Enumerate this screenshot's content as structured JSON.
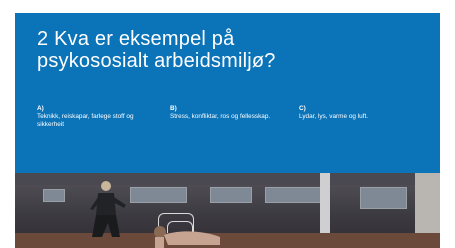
{
  "slide": {
    "title_line1": "2 Kva er eksempel på",
    "title_line2": "psykososialt arbeidsmiljø?",
    "background_color": "#0b73b8"
  },
  "options": [
    {
      "letter": "A)",
      "text": "Teknikk, reiskapar, farlege stoff og sikkerheit"
    },
    {
      "letter": "B)",
      "text": "Stress, konfliktar, ros og fellesskap."
    },
    {
      "letter": "C)",
      "text": "Lydar, lys, varme og luft."
    }
  ]
}
